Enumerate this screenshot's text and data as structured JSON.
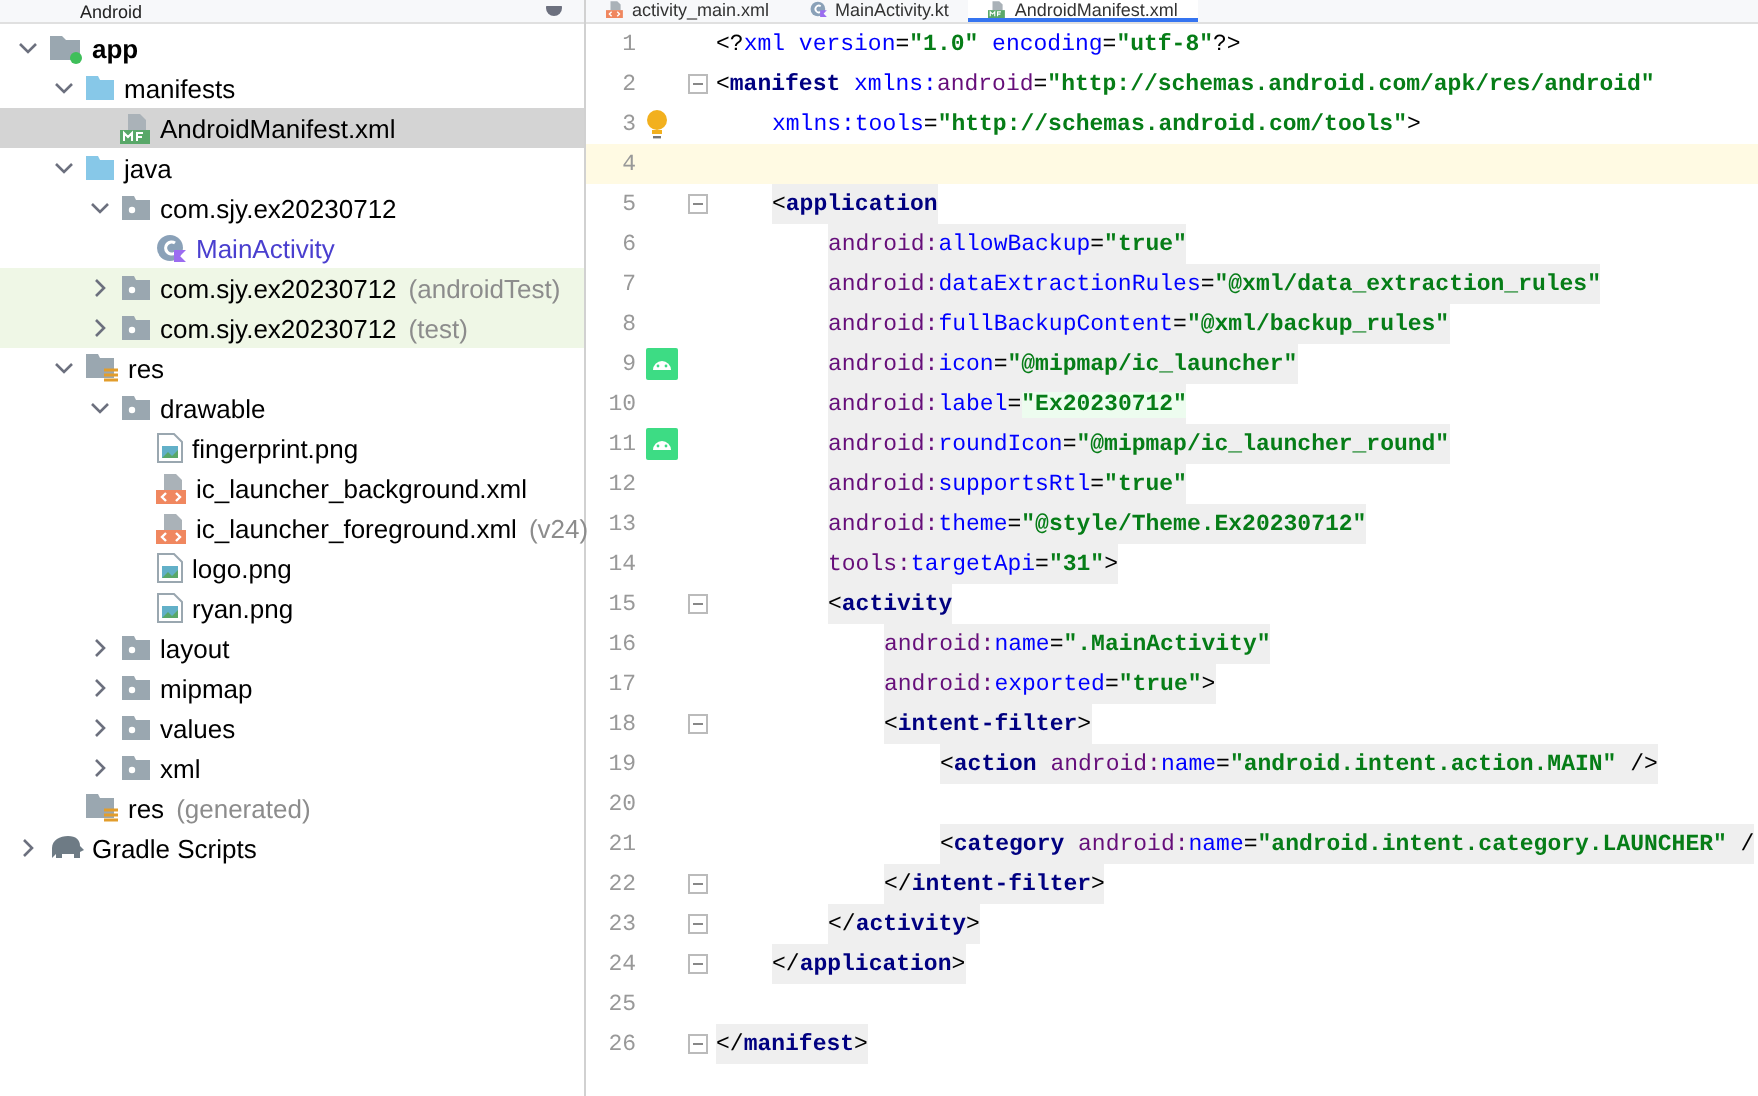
{
  "project_panel": {
    "view": "Android",
    "tree": [
      {
        "label": "app",
        "kind": "module",
        "expanded": true,
        "selected": false,
        "bold": true,
        "children": [
          {
            "label": "manifests",
            "kind": "folder",
            "expanded": true,
            "selected": false,
            "children": [
              {
                "label": "AndroidManifest.xml",
                "kind": "manifest",
                "selected": true
              }
            ]
          },
          {
            "label": "java",
            "kind": "folder",
            "expanded": true,
            "selected": false,
            "children": [
              {
                "label": "com.sjy.ex20230712",
                "kind": "package",
                "expanded": true,
                "selected": false,
                "children": [
                  {
                    "label": "MainActivity",
                    "kind": "kotlin",
                    "selected": false
                  }
                ]
              },
              {
                "label": "com.sjy.ex20230712",
                "hint": "(androidTest)",
                "kind": "package",
                "expanded": false,
                "selected": false,
                "test": true
              },
              {
                "label": "com.sjy.ex20230712",
                "hint": "(test)",
                "kind": "package",
                "expanded": false,
                "selected": false,
                "test": true
              }
            ]
          },
          {
            "label": "res",
            "kind": "res",
            "expanded": true,
            "selected": false,
            "children": [
              {
                "label": "drawable",
                "kind": "package",
                "expanded": true,
                "selected": false,
                "children": [
                  {
                    "label": "fingerprint.png",
                    "kind": "image",
                    "selected": false
                  },
                  {
                    "label": "ic_launcher_background.xml",
                    "kind": "xml",
                    "selected": false
                  },
                  {
                    "label": "ic_launcher_foreground.xml",
                    "hint": "(v24)",
                    "kind": "xml",
                    "selected": false
                  },
                  {
                    "label": "logo.png",
                    "kind": "image",
                    "selected": false
                  },
                  {
                    "label": "ryan.png",
                    "kind": "image",
                    "selected": false
                  }
                ]
              },
              {
                "label": "layout",
                "kind": "package",
                "expanded": false,
                "selected": false
              },
              {
                "label": "mipmap",
                "kind": "package",
                "expanded": false,
                "selected": false
              },
              {
                "label": "values",
                "kind": "package",
                "expanded": false,
                "selected": false
              },
              {
                "label": "xml",
                "kind": "package",
                "expanded": false,
                "selected": false
              }
            ]
          },
          {
            "label": "res",
            "hint": "(generated)",
            "kind": "res",
            "selected": false
          }
        ]
      },
      {
        "label": "Gradle Scripts",
        "kind": "gradle",
        "expanded": false,
        "selected": false
      }
    ]
  },
  "tabs": [
    {
      "label": "activity_main.xml",
      "kind": "xml",
      "selected": false
    },
    {
      "label": "MainActivity.kt",
      "kind": "kotlin",
      "selected": false
    },
    {
      "label": "AndroidManifest.xml",
      "kind": "manifest",
      "selected": true
    }
  ],
  "editor": {
    "lines": [
      {
        "number": "1",
        "highlighted": false,
        "tokens": [
          {
            "kind": "punct",
            "text": "<?"
          },
          {
            "kind": "attr",
            "text": "xml version"
          },
          {
            "kind": "punct",
            "text": "="
          },
          {
            "kind": "value",
            "text": "\"1.0\""
          },
          {
            "kind": "attr",
            "text": " encoding"
          },
          {
            "kind": "punct",
            "text": "="
          },
          {
            "kind": "value",
            "text": "\"utf-8\""
          },
          {
            "kind": "punct",
            "text": "?>"
          }
        ]
      },
      {
        "number": "2",
        "fold": true,
        "highlighted": false,
        "tokens": [
          {
            "kind": "punct",
            "text": "<"
          },
          {
            "kind": "tag",
            "text": "manifest "
          },
          {
            "kind": "attr",
            "text": "xmlns:"
          },
          {
            "kind": "ns",
            "text": "android"
          },
          {
            "kind": "punct",
            "text": "="
          },
          {
            "kind": "value",
            "text": "\"http://schemas.android.com/apk/res/android\""
          }
        ],
        "children": [
          {
            "number": "3",
            "kind": "bulb",
            "highlighted": false,
            "tokens": [
              {
                "kind": "attr",
                "text": "xmlns:tools"
              },
              {
                "kind": "punct",
                "text": "="
              },
              {
                "kind": "value",
                "text": "\"http://schemas.android.com/tools\""
              },
              {
                "kind": "punct",
                "text": ">"
              }
            ]
          },
          {
            "number": "4",
            "current": true
          },
          {
            "number": "5",
            "fold": true,
            "highlighted": true,
            "tokens": [
              {
                "kind": "punct",
                "text": "<"
              },
              {
                "kind": "tag",
                "text": "application"
              }
            ],
            "children": [
              {
                "number": "6",
                "highlighted": true,
                "tokens": [
                  {
                    "kind": "ns",
                    "text": "android:"
                  },
                  {
                    "kind": "attr",
                    "text": "allowBackup"
                  },
                  {
                    "kind": "punct",
                    "text": "="
                  },
                  {
                    "kind": "value",
                    "text": "\"true\""
                  }
                ]
              },
              {
                "number": "7",
                "highlighted": true,
                "tokens": [
                  {
                    "kind": "ns",
                    "text": "android:"
                  },
                  {
                    "kind": "attr",
                    "text": "dataExtractionRules"
                  },
                  {
                    "kind": "punct",
                    "text": "="
                  },
                  {
                    "kind": "value",
                    "text": "\"@xml/data_extraction_rules\""
                  }
                ]
              },
              {
                "number": "8",
                "highlighted": true,
                "tokens": [
                  {
                    "kind": "ns",
                    "text": "android:"
                  },
                  {
                    "kind": "attr",
                    "text": "fullBackupContent"
                  },
                  {
                    "kind": "punct",
                    "text": "="
                  },
                  {
                    "kind": "value",
                    "text": "\"@xml/backup_rules\""
                  }
                ]
              },
              {
                "number": "9",
                "kind": "android",
                "highlighted": true,
                "tokens": [
                  {
                    "kind": "ns",
                    "text": "android:"
                  },
                  {
                    "kind": "attr",
                    "text": "icon"
                  },
                  {
                    "kind": "punct",
                    "text": "="
                  },
                  {
                    "kind": "value",
                    "text": "\"@mipmap/ic_launcher\""
                  }
                ]
              },
              {
                "number": "10",
                "highlighted": true,
                "tokens": [
                  {
                    "kind": "ns",
                    "text": "android:"
                  },
                  {
                    "kind": "attr",
                    "text": "label"
                  },
                  {
                    "kind": "punct",
                    "text": "="
                  },
                  {
                    "kind": "literal",
                    "text": "\"Ex20230712\""
                  }
                ]
              },
              {
                "number": "11",
                "kind": "android",
                "highlighted": true,
                "tokens": [
                  {
                    "kind": "ns",
                    "text": "android:"
                  },
                  {
                    "kind": "attr",
                    "text": "roundIcon"
                  },
                  {
                    "kind": "punct",
                    "text": "="
                  },
                  {
                    "kind": "value",
                    "text": "\"@mipmap/ic_launcher_round\""
                  }
                ]
              },
              {
                "number": "12",
                "highlighted": true,
                "tokens": [
                  {
                    "kind": "ns",
                    "text": "android:"
                  },
                  {
                    "kind": "attr",
                    "text": "supportsRtl"
                  },
                  {
                    "kind": "punct",
                    "text": "="
                  },
                  {
                    "kind": "value",
                    "text": "\"true\""
                  }
                ]
              },
              {
                "number": "13",
                "highlighted": true,
                "tokens": [
                  {
                    "kind": "ns",
                    "text": "android:"
                  },
                  {
                    "kind": "attr",
                    "text": "theme"
                  },
                  {
                    "kind": "punct",
                    "text": "="
                  },
                  {
                    "kind": "value",
                    "text": "\"@style/Theme.Ex20230712\""
                  }
                ]
              },
              {
                "number": "14",
                "highlighted": true,
                "tokens": [
                  {
                    "kind": "ns",
                    "text": "tools:"
                  },
                  {
                    "kind": "attr",
                    "text": "targetApi"
                  },
                  {
                    "kind": "punct",
                    "text": "="
                  },
                  {
                    "kind": "value",
                    "text": "\"31\""
                  },
                  {
                    "kind": "punct",
                    "text": ">"
                  }
                ]
              },
              {
                "number": "15",
                "fold": true,
                "highlighted": true,
                "tokens": [
                  {
                    "kind": "punct",
                    "text": "<"
                  },
                  {
                    "kind": "tag",
                    "text": "activity"
                  }
                ],
                "children": [
                  {
                    "number": "16",
                    "highlighted": true,
                    "tokens": [
                      {
                        "kind": "ns",
                        "text": "android:"
                      },
                      {
                        "kind": "attr",
                        "text": "name"
                      },
                      {
                        "kind": "punct",
                        "text": "="
                      },
                      {
                        "kind": "value",
                        "text": "\".MainActivity\""
                      }
                    ]
                  },
                  {
                    "number": "17",
                    "highlighted": true,
                    "tokens": [
                      {
                        "kind": "ns",
                        "text": "android:"
                      },
                      {
                        "kind": "attr",
                        "text": "exported"
                      },
                      {
                        "kind": "punct",
                        "text": "="
                      },
                      {
                        "kind": "value",
                        "text": "\"true\""
                      },
                      {
                        "kind": "punct",
                        "text": ">"
                      }
                    ]
                  },
                  {
                    "number": "18",
                    "fold": true,
                    "highlighted": true,
                    "tokens": [
                      {
                        "kind": "punct",
                        "text": "<"
                      },
                      {
                        "kind": "tag",
                        "text": "intent-filter"
                      },
                      {
                        "kind": "punct",
                        "text": ">"
                      }
                    ],
                    "children": [
                      {
                        "number": "19",
                        "highlighted": true,
                        "tokens": [
                          {
                            "kind": "punct",
                            "text": "<"
                          },
                          {
                            "kind": "tag",
                            "text": "action "
                          },
                          {
                            "kind": "ns",
                            "text": "android:"
                          },
                          {
                            "kind": "attr",
                            "text": "name"
                          },
                          {
                            "kind": "punct",
                            "text": "="
                          },
                          {
                            "kind": "value",
                            "text": "\"android.intent.action.MAIN\""
                          },
                          {
                            "kind": "punct",
                            "text": " />"
                          }
                        ]
                      },
                      {
                        "number": "20"
                      },
                      {
                        "number": "21",
                        "highlighted": true,
                        "tokens": [
                          {
                            "kind": "punct",
                            "text": "<"
                          },
                          {
                            "kind": "tag",
                            "text": "category "
                          },
                          {
                            "kind": "ns",
                            "text": "android:"
                          },
                          {
                            "kind": "attr",
                            "text": "name"
                          },
                          {
                            "kind": "punct",
                            "text": "="
                          },
                          {
                            "kind": "value",
                            "text": "\"android.intent.category.LAUNCHER\""
                          },
                          {
                            "kind": "punct",
                            "text": " /"
                          }
                        ]
                      }
                    ]
                  },
                  {
                    "number": "22",
                    "fold": true,
                    "highlighted": true,
                    "tokens": [
                      {
                        "kind": "punct",
                        "text": "</"
                      },
                      {
                        "kind": "tag",
                        "text": "intent-filter"
                      },
                      {
                        "kind": "punct",
                        "text": ">"
                      }
                    ]
                  }
                ]
              },
              {
                "number": "23",
                "fold": true,
                "highlighted": true,
                "tokens": [
                  {
                    "kind": "punct",
                    "text": "</"
                  },
                  {
                    "kind": "tag",
                    "text": "activity"
                  },
                  {
                    "kind": "punct",
                    "text": ">"
                  }
                ]
              }
            ]
          },
          {
            "number": "24",
            "fold": true,
            "highlighted": true,
            "tokens": [
              {
                "kind": "punct",
                "text": "</"
              },
              {
                "kind": "tag",
                "text": "application"
              },
              {
                "kind": "punct",
                "text": ">"
              }
            ]
          },
          {
            "number": "25"
          }
        ]
      },
      {
        "number": "26",
        "fold": true,
        "highlighted": true,
        "tokens": [
          {
            "kind": "punct",
            "text": "</"
          },
          {
            "kind": "tag",
            "text": "manifest"
          },
          {
            "kind": "punct",
            "text": ">"
          }
        ]
      }
    ]
  }
}
